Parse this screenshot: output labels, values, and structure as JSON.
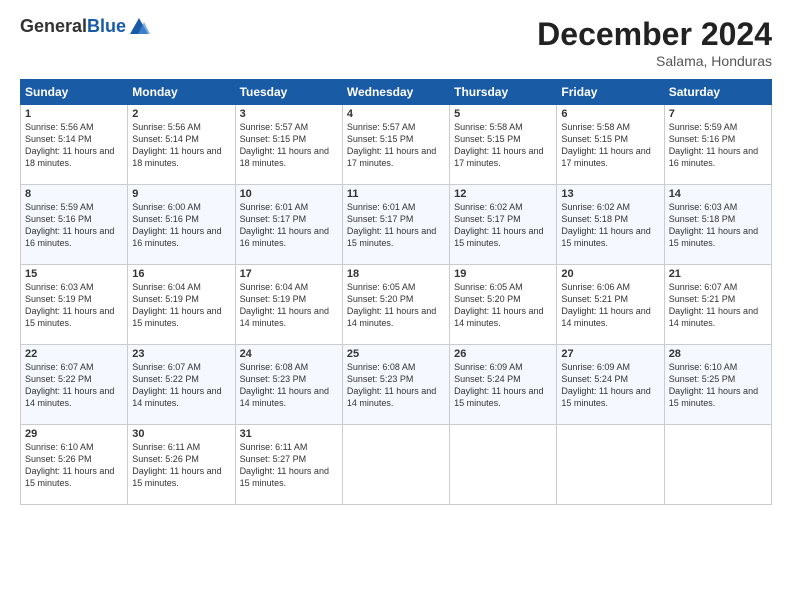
{
  "logo": {
    "general": "General",
    "blue": "Blue"
  },
  "header": {
    "title": "December 2024",
    "subtitle": "Salama, Honduras"
  },
  "weekdays": [
    "Sunday",
    "Monday",
    "Tuesday",
    "Wednesday",
    "Thursday",
    "Friday",
    "Saturday"
  ],
  "weeks": [
    [
      {
        "day": "1",
        "sunrise": "5:56 AM",
        "sunset": "5:14 PM",
        "daylight": "11 hours and 18 minutes."
      },
      {
        "day": "2",
        "sunrise": "5:56 AM",
        "sunset": "5:14 PM",
        "daylight": "11 hours and 18 minutes."
      },
      {
        "day": "3",
        "sunrise": "5:57 AM",
        "sunset": "5:15 PM",
        "daylight": "11 hours and 18 minutes."
      },
      {
        "day": "4",
        "sunrise": "5:57 AM",
        "sunset": "5:15 PM",
        "daylight": "11 hours and 17 minutes."
      },
      {
        "day": "5",
        "sunrise": "5:58 AM",
        "sunset": "5:15 PM",
        "daylight": "11 hours and 17 minutes."
      },
      {
        "day": "6",
        "sunrise": "5:58 AM",
        "sunset": "5:15 PM",
        "daylight": "11 hours and 17 minutes."
      },
      {
        "day": "7",
        "sunrise": "5:59 AM",
        "sunset": "5:16 PM",
        "daylight": "11 hours and 16 minutes."
      }
    ],
    [
      {
        "day": "8",
        "sunrise": "5:59 AM",
        "sunset": "5:16 PM",
        "daylight": "11 hours and 16 minutes."
      },
      {
        "day": "9",
        "sunrise": "6:00 AM",
        "sunset": "5:16 PM",
        "daylight": "11 hours and 16 minutes."
      },
      {
        "day": "10",
        "sunrise": "6:01 AM",
        "sunset": "5:17 PM",
        "daylight": "11 hours and 16 minutes."
      },
      {
        "day": "11",
        "sunrise": "6:01 AM",
        "sunset": "5:17 PM",
        "daylight": "11 hours and 15 minutes."
      },
      {
        "day": "12",
        "sunrise": "6:02 AM",
        "sunset": "5:17 PM",
        "daylight": "11 hours and 15 minutes."
      },
      {
        "day": "13",
        "sunrise": "6:02 AM",
        "sunset": "5:18 PM",
        "daylight": "11 hours and 15 minutes."
      },
      {
        "day": "14",
        "sunrise": "6:03 AM",
        "sunset": "5:18 PM",
        "daylight": "11 hours and 15 minutes."
      }
    ],
    [
      {
        "day": "15",
        "sunrise": "6:03 AM",
        "sunset": "5:19 PM",
        "daylight": "11 hours and 15 minutes."
      },
      {
        "day": "16",
        "sunrise": "6:04 AM",
        "sunset": "5:19 PM",
        "daylight": "11 hours and 15 minutes."
      },
      {
        "day": "17",
        "sunrise": "6:04 AM",
        "sunset": "5:19 PM",
        "daylight": "11 hours and 14 minutes."
      },
      {
        "day": "18",
        "sunrise": "6:05 AM",
        "sunset": "5:20 PM",
        "daylight": "11 hours and 14 minutes."
      },
      {
        "day": "19",
        "sunrise": "6:05 AM",
        "sunset": "5:20 PM",
        "daylight": "11 hours and 14 minutes."
      },
      {
        "day": "20",
        "sunrise": "6:06 AM",
        "sunset": "5:21 PM",
        "daylight": "11 hours and 14 minutes."
      },
      {
        "day": "21",
        "sunrise": "6:07 AM",
        "sunset": "5:21 PM",
        "daylight": "11 hours and 14 minutes."
      }
    ],
    [
      {
        "day": "22",
        "sunrise": "6:07 AM",
        "sunset": "5:22 PM",
        "daylight": "11 hours and 14 minutes."
      },
      {
        "day": "23",
        "sunrise": "6:07 AM",
        "sunset": "5:22 PM",
        "daylight": "11 hours and 14 minutes."
      },
      {
        "day": "24",
        "sunrise": "6:08 AM",
        "sunset": "5:23 PM",
        "daylight": "11 hours and 14 minutes."
      },
      {
        "day": "25",
        "sunrise": "6:08 AM",
        "sunset": "5:23 PM",
        "daylight": "11 hours and 14 minutes."
      },
      {
        "day": "26",
        "sunrise": "6:09 AM",
        "sunset": "5:24 PM",
        "daylight": "11 hours and 15 minutes."
      },
      {
        "day": "27",
        "sunrise": "6:09 AM",
        "sunset": "5:24 PM",
        "daylight": "11 hours and 15 minutes."
      },
      {
        "day": "28",
        "sunrise": "6:10 AM",
        "sunset": "5:25 PM",
        "daylight": "11 hours and 15 minutes."
      }
    ],
    [
      {
        "day": "29",
        "sunrise": "6:10 AM",
        "sunset": "5:26 PM",
        "daylight": "11 hours and 15 minutes."
      },
      {
        "day": "30",
        "sunrise": "6:11 AM",
        "sunset": "5:26 PM",
        "daylight": "11 hours and 15 minutes."
      },
      {
        "day": "31",
        "sunrise": "6:11 AM",
        "sunset": "5:27 PM",
        "daylight": "11 hours and 15 minutes."
      },
      null,
      null,
      null,
      null
    ]
  ]
}
